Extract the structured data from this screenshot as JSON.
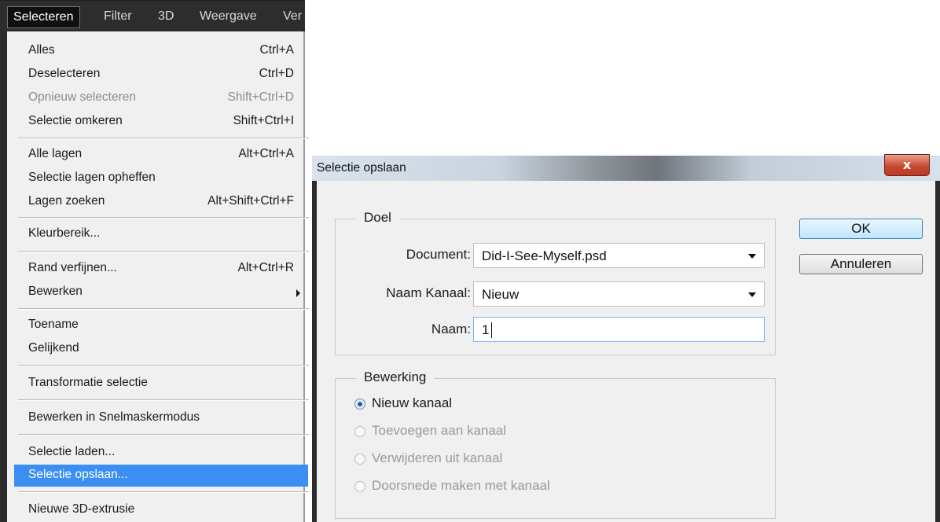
{
  "menubar": {
    "items": [
      "Selecteren",
      "Filter",
      "3D",
      "Weergave",
      "Ver"
    ]
  },
  "menu": {
    "items": [
      {
        "label": "Alles",
        "shortcut": "Ctrl+A"
      },
      {
        "label": "Deselecteren",
        "shortcut": "Ctrl+D"
      },
      {
        "label": "Opnieuw selecteren",
        "shortcut": "Shift+Ctrl+D"
      },
      {
        "label": "Selectie omkeren",
        "shortcut": "Shift+Ctrl+I"
      },
      {
        "label": "Alle lagen",
        "shortcut": "Alt+Ctrl+A"
      },
      {
        "label": "Selectie lagen opheffen",
        "shortcut": ""
      },
      {
        "label": "Lagen zoeken",
        "shortcut": "Alt+Shift+Ctrl+F"
      },
      {
        "label": "Kleurbereik...",
        "shortcut": ""
      },
      {
        "label": "Rand verfijnen...",
        "shortcut": "Alt+Ctrl+R"
      },
      {
        "label": "Bewerken",
        "shortcut": ""
      },
      {
        "label": "Toename",
        "shortcut": ""
      },
      {
        "label": "Gelijkend",
        "shortcut": ""
      },
      {
        "label": "Transformatie selectie",
        "shortcut": ""
      },
      {
        "label": "Bewerken in Snelmaskermodus",
        "shortcut": ""
      },
      {
        "label": "Selectie laden...",
        "shortcut": ""
      },
      {
        "label": "Selectie opslaan...",
        "shortcut": ""
      },
      {
        "label": "Nieuwe 3D-extrusie",
        "shortcut": ""
      }
    ]
  },
  "dialog": {
    "title": "Selectie opslaan",
    "close_label": "x",
    "doel": {
      "legend": "Doel",
      "document_label": "Document:",
      "document_value": "Did-I-See-Myself.psd",
      "kanaal_label": "Naam Kanaal:",
      "kanaal_value": "Nieuw",
      "naam_label": "Naam:",
      "naam_value": "1"
    },
    "bewerking": {
      "legend": "Bewerking",
      "options": [
        "Nieuw kanaal",
        "Toevoegen aan kanaal",
        "Verwijderen uit kanaal",
        "Doorsnede maken met kanaal"
      ],
      "selected": "Nieuw kanaal"
    },
    "ok_label": "OK",
    "cancel_label": "Annuleren"
  }
}
